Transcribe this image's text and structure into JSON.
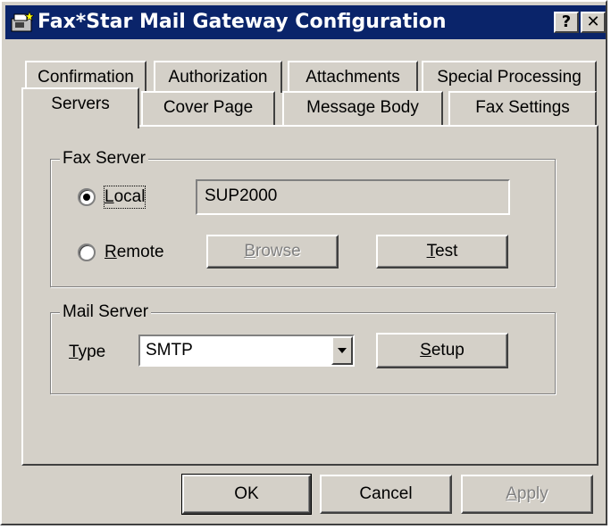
{
  "window": {
    "title": "Fax*Star Mail Gateway Configuration",
    "help_glyph": "?",
    "close_glyph": "✕"
  },
  "tabs": {
    "row1": [
      "Confirmation",
      "Authorization",
      "Attachments",
      "Special Processing"
    ],
    "row2": [
      "Servers",
      "Cover Page",
      "Message Body",
      "Fax Settings"
    ],
    "active": "Servers"
  },
  "fax_server": {
    "group_label": "Fax Server",
    "local": {
      "prefix": "",
      "accel": "L",
      "rest": "ocal",
      "selected": true
    },
    "remote": {
      "prefix": "",
      "accel": "R",
      "rest": "emote",
      "selected": false
    },
    "server_name": "SUP2000",
    "browse": {
      "prefix": "",
      "accel": "B",
      "rest": "rowse",
      "enabled": false
    },
    "test": {
      "prefix": "",
      "accel": "T",
      "rest": "est",
      "enabled": true
    }
  },
  "mail_server": {
    "group_label": "Mail Server",
    "type_label": {
      "prefix": "",
      "accel": "T",
      "rest": "ype"
    },
    "type_value": "SMTP",
    "setup": {
      "prefix": "",
      "accel": "S",
      "rest": "etup"
    }
  },
  "footer": {
    "ok": "OK",
    "cancel": "Cancel",
    "apply": {
      "prefix": "",
      "accel": "A",
      "rest": "pply",
      "enabled": false
    }
  },
  "colors": {
    "face": "#d4d0c8",
    "title_bar": "#0a246a",
    "disabled_text": "#808080"
  }
}
